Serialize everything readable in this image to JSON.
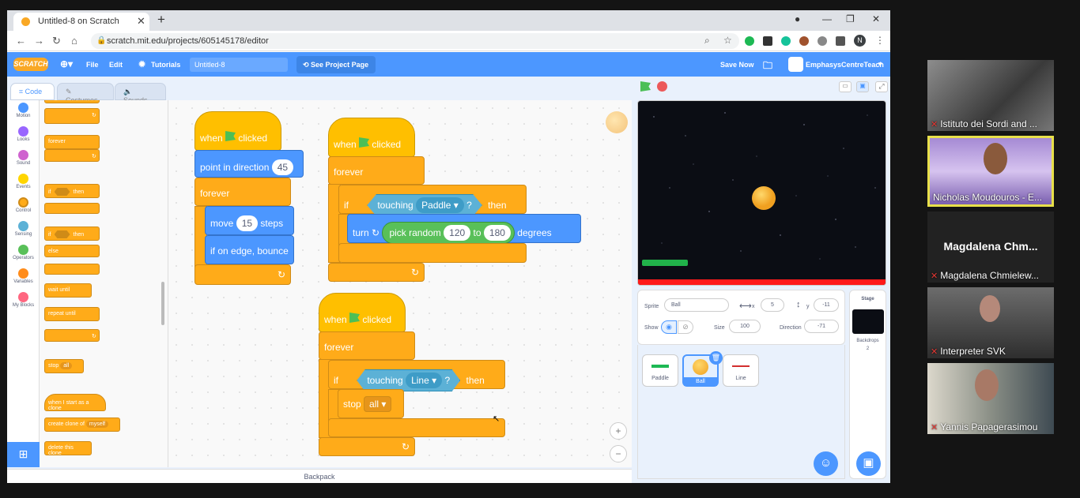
{
  "browser": {
    "tab_title": "Untitled-8 on Scratch",
    "url": "scratch.mit.edu/projects/605145178/editor",
    "avatar_letter": "N"
  },
  "menubar": {
    "logo": "SCRATCH",
    "file": "File",
    "edit": "Edit",
    "tutorials": "Tutorials",
    "project_name": "Untitled-8",
    "see_project": "See Project Page",
    "save_now": "Save Now",
    "user": "EmphasysCentreTeach"
  },
  "tabs": {
    "code": "Code",
    "costumes": "Costumes",
    "sounds": "Sounds"
  },
  "categories": [
    {
      "label": "Motion",
      "color": "#4c97ff"
    },
    {
      "label": "Looks",
      "color": "#9966ff"
    },
    {
      "label": "Sound",
      "color": "#cf63cf"
    },
    {
      "label": "Events",
      "color": "#ffd500"
    },
    {
      "label": "Control",
      "color": "#ffab19"
    },
    {
      "label": "Sensing",
      "color": "#5cb1d6"
    },
    {
      "label": "Operators",
      "color": "#59c059"
    },
    {
      "label": "Variables",
      "color": "#ff8c1a"
    },
    {
      "label": "My Blocks",
      "color": "#ff6680"
    }
  ],
  "palette": {
    "forever": "forever",
    "if": "if",
    "then": "then",
    "then2": "then",
    "else": "else",
    "wait_until": "wait until",
    "repeat_until": "repeat until",
    "stop": "stop",
    "stop_opt": "all",
    "when_clone": "when I start as a clone",
    "create_clone": "create clone of",
    "create_opt": "myself",
    "delete_clone": "delete this clone"
  },
  "script1": {
    "when": "when",
    "clicked": "clicked",
    "point": "point in direction",
    "dir": "45",
    "forever": "forever",
    "move": "move",
    "steps_val": "15",
    "steps": "steps",
    "bounce": "if on edge, bounce"
  },
  "script2": {
    "when": "when",
    "clicked": "clicked",
    "forever": "forever",
    "if": "if",
    "touching": "touching",
    "target": "Paddle",
    "q": "?",
    "then": "then",
    "turn": "turn",
    "pick": "pick random",
    "from": "120",
    "to": "to",
    "upto": "180",
    "degrees": "degrees"
  },
  "script3": {
    "when": "when",
    "clicked": "clicked",
    "forever": "forever",
    "if": "if",
    "touching": "touching",
    "target": "Line",
    "q": "?",
    "then": "then",
    "stop": "stop",
    "stop_opt": "all"
  },
  "backpack": "Backpack",
  "sprite": {
    "label": "Sprite",
    "name": "Ball",
    "x_label": "x",
    "x": "5",
    "y_label": "y",
    "y": "-11",
    "show": "Show",
    "size_label": "Size",
    "size": "100",
    "dir_label": "Direction",
    "dir": "-71"
  },
  "sprites": [
    {
      "name": "Paddle",
      "color": "#1db954"
    },
    {
      "name": "Ball",
      "color": "#f9a825"
    },
    {
      "name": "Line",
      "color": "#d32f2f"
    }
  ],
  "stage_pane": {
    "title": "Stage",
    "backdrops": "Backdrops",
    "count": "2"
  },
  "participants": [
    {
      "name": "Istituto dei Sordi and ...",
      "bg": "#6b6b6b"
    },
    {
      "name": "Nicholas Moudouros - E...",
      "bg": "#b6a0d8"
    },
    {
      "name": "Magdalena Chmielew...",
      "display": "Magdalena  Chm...",
      "bg": "#222222"
    },
    {
      "name": "Interpreter SVK",
      "bg": "#4a4a4a"
    },
    {
      "name": "Yannis Papagerasimou",
      "bg": "#5a6a72"
    }
  ]
}
